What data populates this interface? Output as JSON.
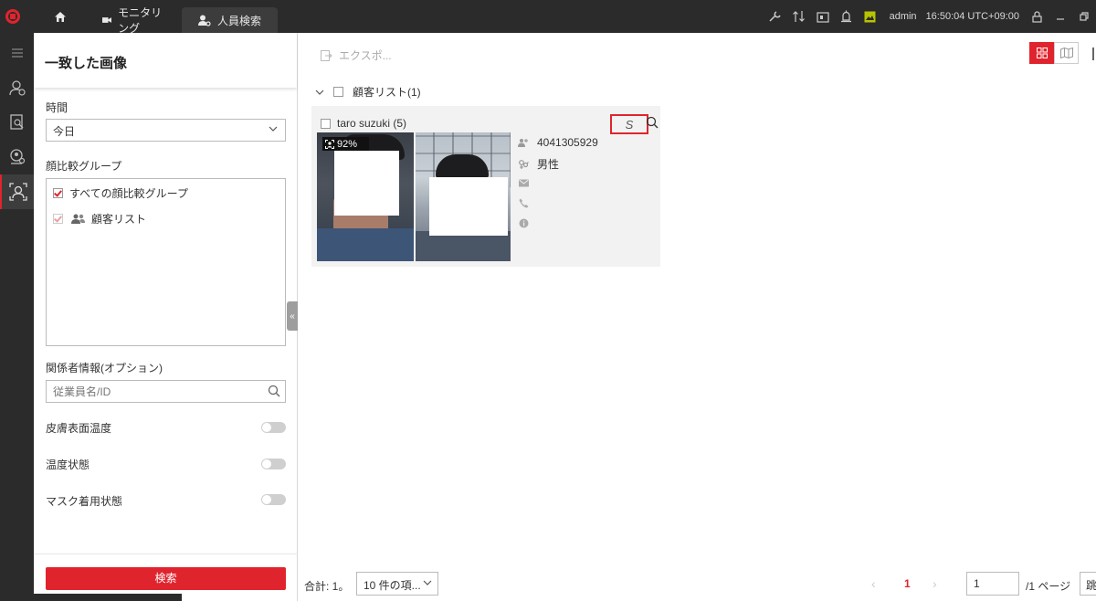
{
  "topbar": {
    "tabs": [
      {
        "label": "モニタリング",
        "icon": "camera-icon"
      },
      {
        "label": "人員検索",
        "icon": "person-search-icon"
      }
    ],
    "user": "admin",
    "time": "16:50:04 UTC+09:00"
  },
  "panel": {
    "title": "一致した画像",
    "time_label": "時間",
    "time_value": "今日",
    "group_label": "顔比較グループ",
    "groups": [
      {
        "label": "すべての顔比較グループ",
        "checked": true
      },
      {
        "label": "顧客リスト",
        "checked": true
      }
    ],
    "related_label": "関係者情報(オプション)",
    "related_placeholder": "従業員名/ID",
    "toggles": [
      {
        "label": "皮膚表面温度",
        "on": false
      },
      {
        "label": "温度状態",
        "on": false
      },
      {
        "label": "マスク着用状態",
        "on": false
      }
    ],
    "search_button": "検索"
  },
  "main": {
    "export_label": "エクスポ...",
    "list_header": "顧客リスト(1)",
    "card": {
      "name": "taro suzuki (5)",
      "similarity": "92%",
      "id": "4041305929",
      "gender": "男性",
      "redbox_symbol": "S"
    },
    "footer": {
      "total": "合計: 1。",
      "page_size": "10 件の項...",
      "current_page": "1",
      "page_input": "1",
      "page_of": "/1 ページ",
      "go": "跳"
    }
  },
  "colors": {
    "accent": "#e0242d",
    "dark": "#2b2b2b"
  }
}
